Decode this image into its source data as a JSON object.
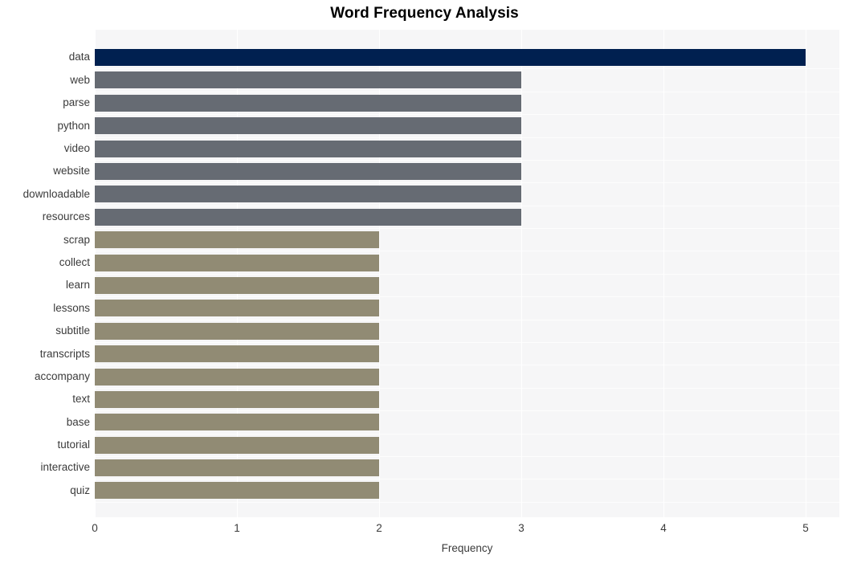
{
  "chart_data": {
    "type": "bar",
    "orientation": "horizontal",
    "title": "Word Frequency Analysis",
    "xlabel": "Frequency",
    "ylabel": "",
    "xlim": [
      0,
      5
    ],
    "xticks": [
      "0",
      "1",
      "2",
      "3",
      "4",
      "5"
    ],
    "grid": true,
    "legend": "none",
    "categories": [
      "data",
      "web",
      "parse",
      "python",
      "video",
      "website",
      "downloadable",
      "resources",
      "scrap",
      "collect",
      "learn",
      "lessons",
      "subtitle",
      "transcripts",
      "accompany",
      "text",
      "base",
      "tutorial",
      "interactive",
      "quiz"
    ],
    "values": [
      5,
      3,
      3,
      3,
      3,
      3,
      3,
      3,
      2,
      2,
      2,
      2,
      2,
      2,
      2,
      2,
      2,
      2,
      2,
      2
    ],
    "bar_colors": [
      "#002050",
      "#666b73",
      "#666b73",
      "#666b73",
      "#666b73",
      "#666b73",
      "#666b73",
      "#666b73",
      "#918b74",
      "#918b74",
      "#918b74",
      "#918b74",
      "#918b74",
      "#918b74",
      "#918b74",
      "#918b74",
      "#918b74",
      "#918b74",
      "#918b74",
      "#918b74"
    ]
  },
  "colors": {
    "plot_background": "#f6f6f7",
    "page_background": "#ffffff",
    "gridline": "#ffffff",
    "title_text": "#000000",
    "axis_text": "#3b3b3b",
    "value_5": "#002050",
    "value_3": "#666b73",
    "value_2": "#918b74"
  }
}
